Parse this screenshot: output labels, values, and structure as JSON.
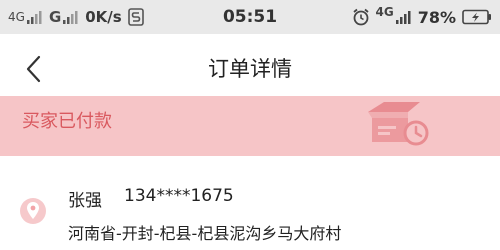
{
  "status_bar": {
    "network_1": "4G",
    "network_2": "G",
    "speed": "0K/s",
    "time": "05:51",
    "network_right": "4G",
    "battery_percent": "78%"
  },
  "nav": {
    "title": "订单详情"
  },
  "banner": {
    "status_text": "买家已付款"
  },
  "address": {
    "name": "张强",
    "phone": "134****1675",
    "full_address": "河南省-开封-杞县-杞县泥沟乡马大府村"
  },
  "colors": {
    "banner_bg": "#f6c5c7",
    "banner_text": "#d9595f",
    "location_icon": "#f2a4a8"
  }
}
